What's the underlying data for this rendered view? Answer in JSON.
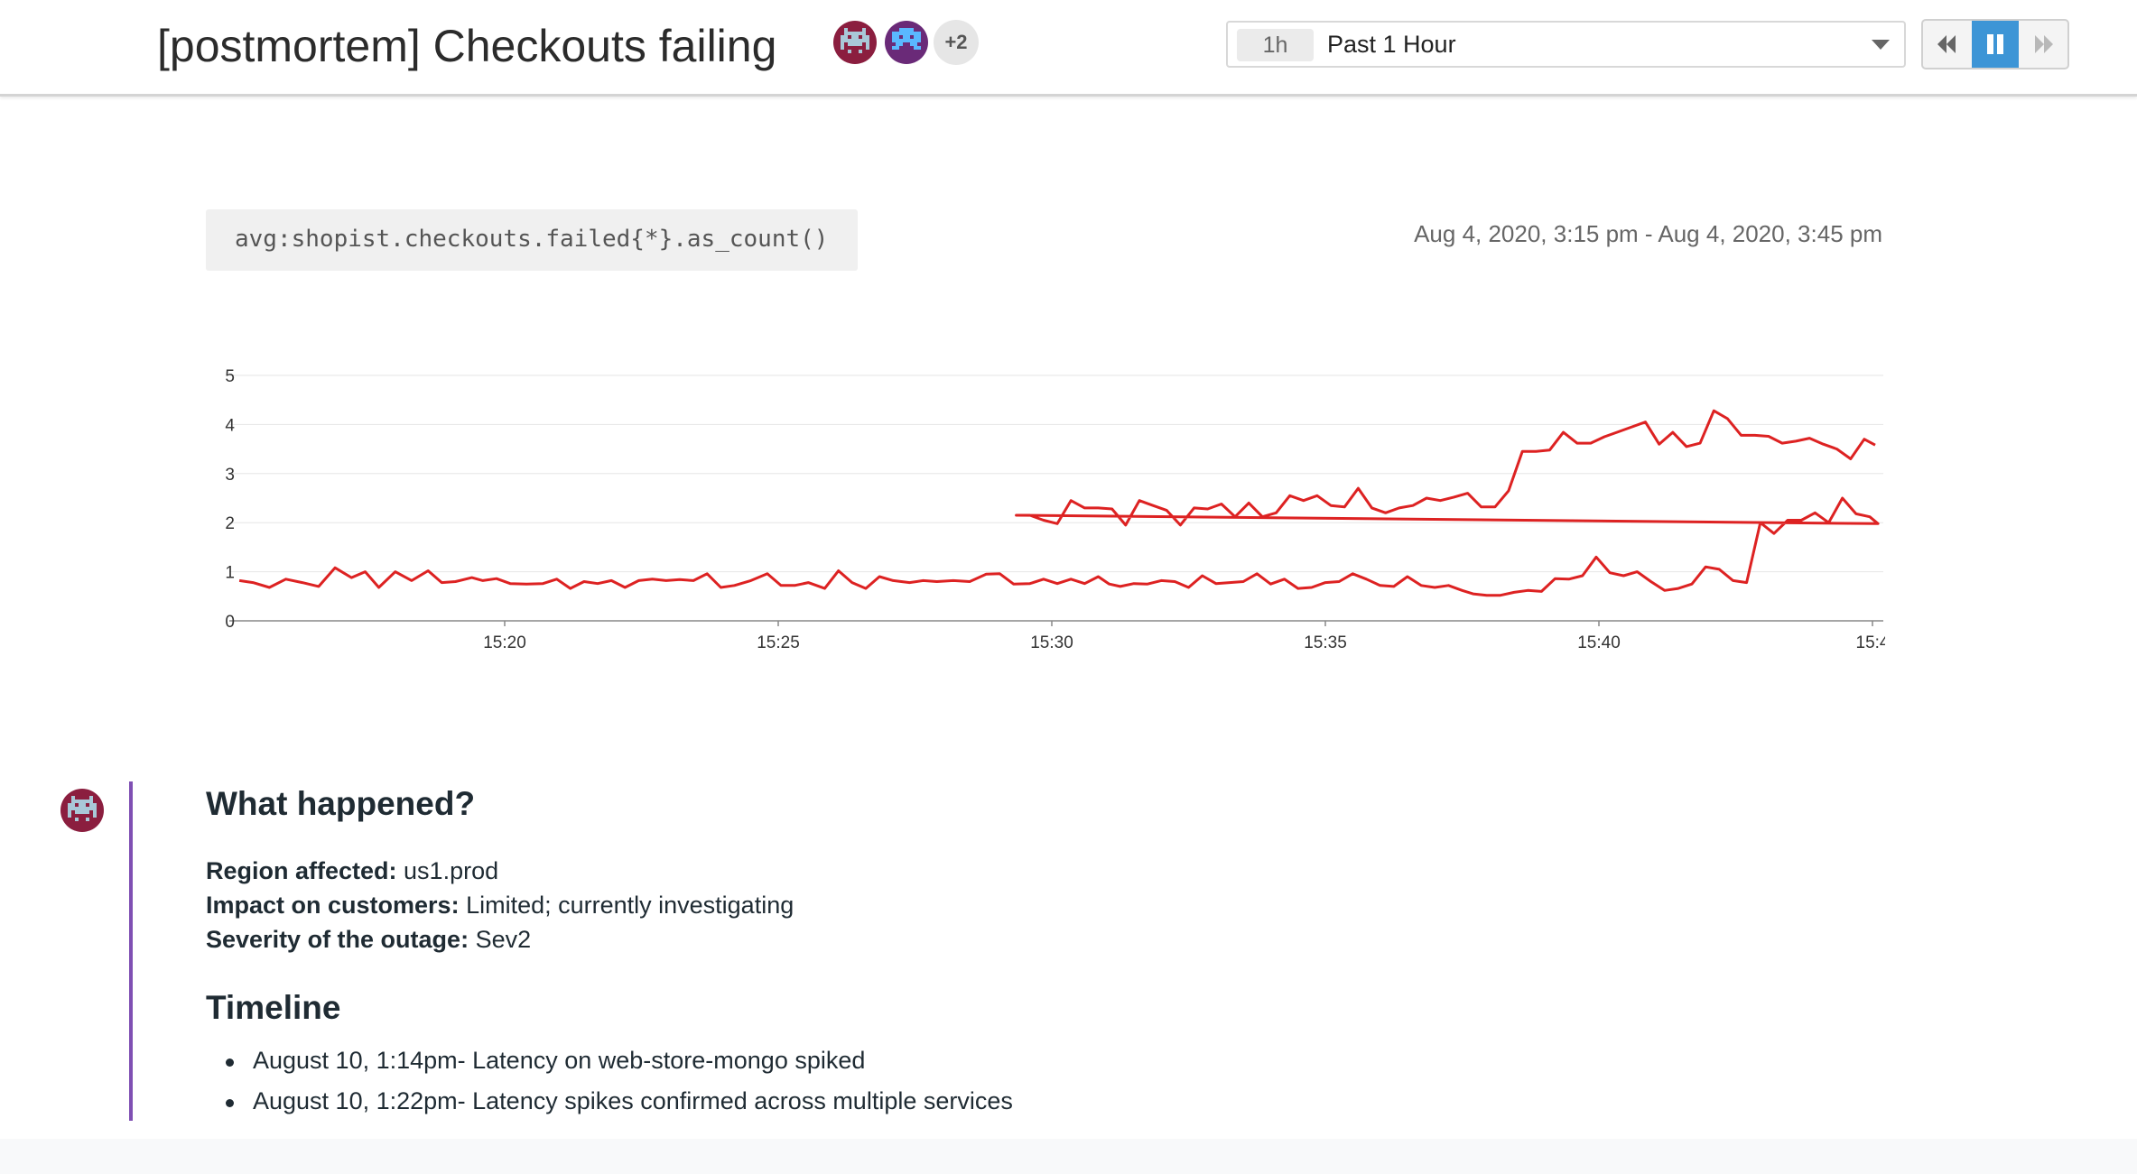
{
  "header": {
    "title": "[postmortem] Checkouts failing",
    "avatars": [
      {
        "icon": "invader-avatar-icon",
        "bg": "#8b1e3f",
        "fg": "#9fc3d6"
      },
      {
        "icon": "invader-avatar-icon",
        "bg": "#6a2a78",
        "fg": "#4fb3ff"
      }
    ],
    "extra_participants": "+2",
    "time_select": {
      "badge": "1h",
      "label": "Past 1 Hour"
    },
    "playback": {
      "rewind_icon": "rewind-icon",
      "pause_icon": "pause-icon",
      "forward_icon": "fast-forward-icon"
    }
  },
  "widget": {
    "query": "avg:shopist.checkouts.failed{*}.as_count()",
    "time_range": "Aug 4, 2020, 3:15 pm - Aug 4, 2020, 3:45 pm"
  },
  "chart_data": {
    "type": "line",
    "title": "",
    "xlabel": "",
    "ylabel": "",
    "y_ticks": [
      "0",
      "1",
      "2",
      "3",
      "4",
      "5"
    ],
    "ylim": [
      0,
      5
    ],
    "x_ticks": [
      {
        "minute": 20,
        "label": "15:20"
      },
      {
        "minute": 25,
        "label": "15:25"
      },
      {
        "minute": 30,
        "label": "15:30"
      },
      {
        "minute": 35,
        "label": "15:35"
      },
      {
        "minute": 40,
        "label": "15:40"
      },
      {
        "minute": 45,
        "label": "15:4"
      }
    ],
    "xlim": [
      15.15,
      45.1
    ],
    "grid": true,
    "series": [
      {
        "color": "#dd2222",
        "x_unit": "minutes past 15:00",
        "points": [
          [
            15.15,
            0.82
          ],
          [
            15.4,
            0.78
          ],
          [
            15.7,
            0.68
          ],
          [
            16.0,
            0.85
          ],
          [
            16.3,
            0.78
          ],
          [
            16.6,
            0.7
          ],
          [
            16.9,
            1.08
          ],
          [
            17.2,
            0.88
          ],
          [
            17.45,
            1.0
          ],
          [
            17.7,
            0.68
          ],
          [
            18.0,
            1.0
          ],
          [
            18.3,
            0.82
          ],
          [
            18.6,
            1.02
          ],
          [
            18.85,
            0.78
          ],
          [
            19.1,
            0.8
          ],
          [
            19.4,
            0.88
          ],
          [
            19.6,
            0.82
          ],
          [
            19.85,
            0.86
          ],
          [
            20.1,
            0.76
          ],
          [
            20.4,
            0.75
          ],
          [
            20.7,
            0.76
          ],
          [
            20.95,
            0.85
          ],
          [
            21.2,
            0.66
          ],
          [
            21.45,
            0.8
          ],
          [
            21.7,
            0.76
          ],
          [
            21.95,
            0.82
          ],
          [
            22.2,
            0.68
          ],
          [
            22.45,
            0.82
          ],
          [
            22.7,
            0.85
          ],
          [
            22.95,
            0.82
          ],
          [
            23.2,
            0.84
          ],
          [
            23.45,
            0.82
          ],
          [
            23.7,
            0.96
          ],
          [
            23.95,
            0.68
          ],
          [
            24.2,
            0.72
          ],
          [
            24.5,
            0.82
          ],
          [
            24.8,
            0.96
          ],
          [
            25.05,
            0.72
          ],
          [
            25.3,
            0.72
          ],
          [
            25.55,
            0.78
          ],
          [
            25.85,
            0.66
          ],
          [
            26.1,
            1.02
          ],
          [
            26.35,
            0.78
          ],
          [
            26.6,
            0.66
          ],
          [
            26.85,
            0.9
          ],
          [
            27.1,
            0.82
          ],
          [
            27.4,
            0.78
          ],
          [
            27.65,
            0.82
          ],
          [
            27.9,
            0.8
          ],
          [
            28.2,
            0.82
          ],
          [
            28.5,
            0.8
          ],
          [
            28.8,
            0.95
          ],
          [
            29.05,
            0.96
          ],
          [
            29.3,
            0.75
          ],
          [
            29.6,
            0.76
          ],
          [
            29.85,
            0.85
          ],
          [
            30.1,
            0.76
          ],
          [
            30.35,
            0.85
          ],
          [
            30.6,
            0.76
          ],
          [
            30.85,
            0.9
          ],
          [
            31.05,
            0.75
          ],
          [
            31.25,
            0.7
          ],
          [
            31.5,
            0.76
          ],
          [
            31.75,
            0.75
          ],
          [
            32.0,
            0.82
          ],
          [
            32.25,
            0.8
          ],
          [
            32.5,
            0.68
          ],
          [
            32.75,
            0.92
          ],
          [
            33.0,
            0.76
          ],
          [
            33.25,
            0.78
          ],
          [
            33.5,
            0.8
          ],
          [
            33.75,
            0.96
          ],
          [
            34.0,
            0.75
          ],
          [
            34.25,
            0.85
          ],
          [
            34.5,
            0.66
          ],
          [
            34.75,
            0.68
          ],
          [
            35.0,
            0.78
          ],
          [
            35.25,
            0.8
          ],
          [
            35.5,
            0.96
          ],
          [
            35.75,
            0.85
          ],
          [
            36.0,
            0.72
          ],
          [
            36.25,
            0.7
          ],
          [
            36.5,
            0.9
          ],
          [
            36.75,
            0.72
          ],
          [
            37.0,
            0.68
          ],
          [
            37.25,
            0.72
          ],
          [
            37.5,
            0.62
          ],
          [
            37.7,
            0.55
          ],
          [
            37.95,
            0.52
          ],
          [
            38.2,
            0.52
          ],
          [
            38.45,
            0.58
          ],
          [
            38.7,
            0.62
          ],
          [
            38.95,
            0.6
          ],
          [
            39.2,
            0.86
          ],
          [
            39.45,
            0.85
          ],
          [
            39.7,
            0.92
          ],
          [
            39.95,
            1.3
          ],
          [
            40.2,
            0.98
          ],
          [
            40.45,
            0.92
          ],
          [
            40.7,
            1.0
          ],
          [
            40.95,
            0.8
          ],
          [
            41.2,
            0.62
          ],
          [
            41.45,
            0.66
          ],
          [
            41.7,
            0.75
          ],
          [
            41.95,
            1.1
          ],
          [
            42.2,
            1.05
          ],
          [
            42.45,
            0.82
          ],
          [
            42.7,
            0.78
          ],
          [
            42.95,
            2.0
          ],
          [
            43.2,
            1.78
          ],
          [
            43.45,
            2.05
          ],
          [
            43.7,
            2.05
          ],
          [
            43.95,
            2.2
          ],
          [
            44.2,
            2.0
          ],
          [
            44.45,
            2.5
          ],
          [
            44.7,
            2.18
          ],
          [
            44.95,
            2.12
          ],
          [
            45.1,
            1.98
          ]
        ]
      }
    ],
    "x_domain_minutes": [
      15,
      45
    ],
    "series_note": ""
  },
  "note": {
    "avatar_icon": "invader-avatar-icon",
    "heading": "What happened?",
    "fields": [
      {
        "label": "Region affected:",
        "value": " us1.prod"
      },
      {
        "label": "Impact on customers:",
        "value": " Limited; currently investigating"
      },
      {
        "label": "Severity of the outage:",
        "value": " Sev2"
      }
    ],
    "timeline_heading": "Timeline",
    "timeline": [
      "August 10, 1:14pm- Latency on web-store-mongo spiked",
      "August 10, 1:22pm- Latency spikes confirmed across multiple services"
    ]
  }
}
